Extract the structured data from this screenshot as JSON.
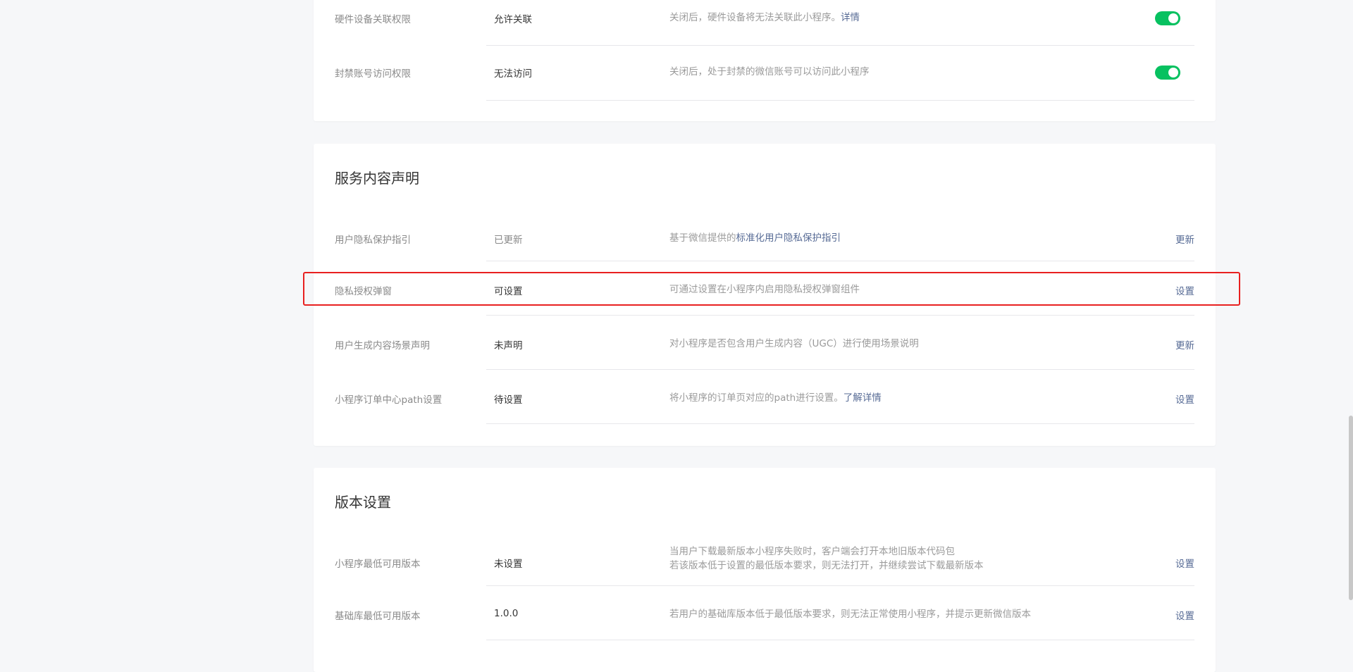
{
  "permissions_section": {
    "rows": [
      {
        "label": "硬件设备关联权限",
        "status": "允许关联",
        "desc": "关闭后，硬件设备将无法关联此小程序。",
        "desc_link": "详情",
        "toggle_on": true
      },
      {
        "label": "封禁账号访问权限",
        "status": "无法访问",
        "desc": "关闭后，处于封禁的微信账号可以访问此小程序",
        "toggle_on": true
      }
    ]
  },
  "service_section": {
    "title": "服务内容声明",
    "rows": [
      {
        "label": "用户隐私保护指引",
        "status": "已更新",
        "desc": "基于微信提供的",
        "desc_link": "标准化用户隐私保护指引",
        "action": "更新"
      },
      {
        "label": "隐私授权弹窗",
        "status": "可设置",
        "desc": "可通过设置在小程序内启用隐私授权弹窗组件",
        "action": "设置"
      },
      {
        "label": "用户生成内容场景声明",
        "status": "未声明",
        "desc": "对小程序是否包含用户生成内容（UGC）进行使用场景说明",
        "action": "更新"
      },
      {
        "label": "小程序订单中心path设置",
        "status": "待设置",
        "desc": "将小程序的订单页对应的path进行设置。",
        "desc_link": "了解详情",
        "action": "设置"
      }
    ]
  },
  "version_section": {
    "title": "版本设置",
    "rows": [
      {
        "label": "小程序最低可用版本",
        "status": "未设置",
        "desc_line1": "当用户下载最新版本小程序失败时，客户端会打开本地旧版本代码包",
        "desc_line2": "若该版本低于设置的最低版本要求，则无法打开，并继续尝试下载最新版本",
        "action": "设置"
      },
      {
        "label": "基础库最低可用版本",
        "status": "1.0.0",
        "desc": "若用户的基础库版本低于最低版本要求，则无法正常使用小程序，并提示更新微信版本",
        "action": "设置"
      }
    ]
  },
  "colors": {
    "accent_link": "#576b95",
    "toggle_on": "#07c160",
    "highlight_box": "#e82020"
  }
}
